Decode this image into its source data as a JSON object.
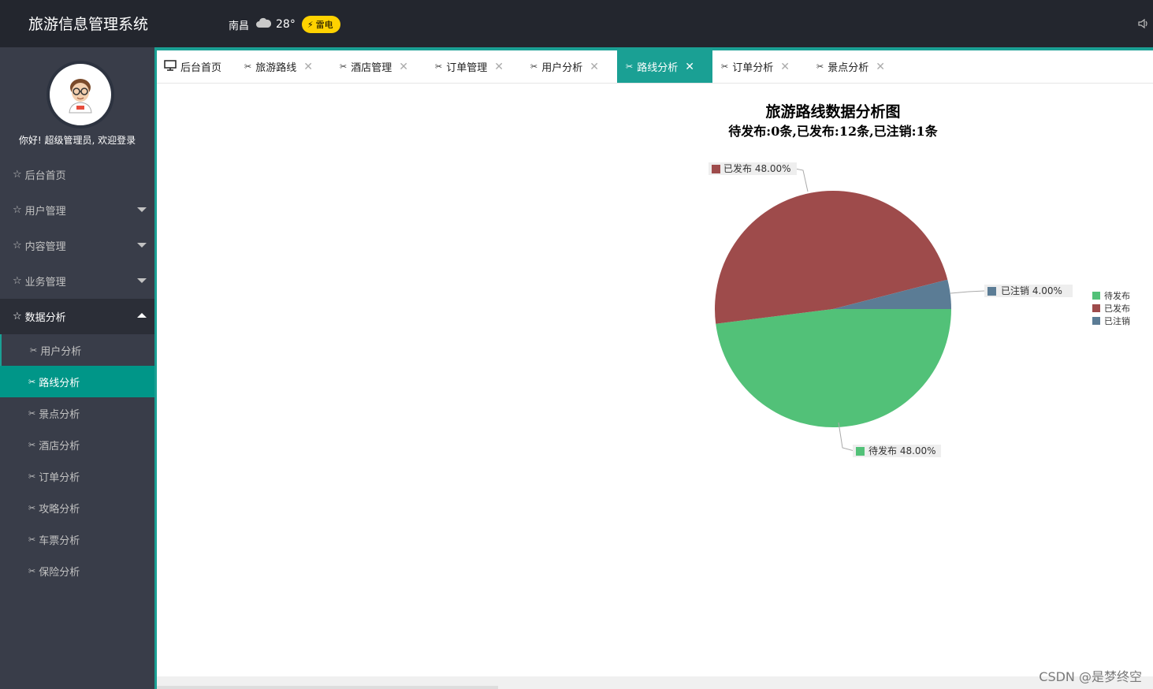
{
  "app": {
    "title": "旅游信息管理系统"
  },
  "weather": {
    "city": "南昌",
    "temp": "28°",
    "condition": "雷电"
  },
  "user": {
    "welcome": "你好! 超级管理员, 欢迎登录"
  },
  "sidebar": {
    "items": [
      {
        "label": "后台首页"
      },
      {
        "label": "用户管理"
      },
      {
        "label": "内容管理"
      },
      {
        "label": "业务管理"
      },
      {
        "label": "数据分析"
      }
    ],
    "subitems": [
      {
        "label": "用户分析"
      },
      {
        "label": "路线分析"
      },
      {
        "label": "景点分析"
      },
      {
        "label": "酒店分析"
      },
      {
        "label": "订单分析"
      },
      {
        "label": "攻略分析"
      },
      {
        "label": "车票分析"
      },
      {
        "label": "保险分析"
      }
    ]
  },
  "tabs": [
    {
      "label": "后台首页"
    },
    {
      "label": "旅游路线"
    },
    {
      "label": "酒店管理"
    },
    {
      "label": "订单管理"
    },
    {
      "label": "用户分析"
    },
    {
      "label": "路线分析"
    },
    {
      "label": "订单分析"
    },
    {
      "label": "景点分析"
    }
  ],
  "chart_data": {
    "type": "pie",
    "title": "旅游路线数据分析图",
    "subtitle": "待发布:0条,已发布:12条,已注销:1条",
    "legend_position": "right",
    "series": [
      {
        "name": "待发布",
        "value": 48.0,
        "label": "待发布 48.00%",
        "color": "#52c178"
      },
      {
        "name": "已发布",
        "value": 48.0,
        "label": "已发布 48.00%",
        "color": "#9e4b4b"
      },
      {
        "name": "已注销",
        "value": 4.0,
        "label": "已注销 4.00%",
        "color": "#5b7c95"
      }
    ]
  },
  "watermark": "CSDN @是梦终空"
}
